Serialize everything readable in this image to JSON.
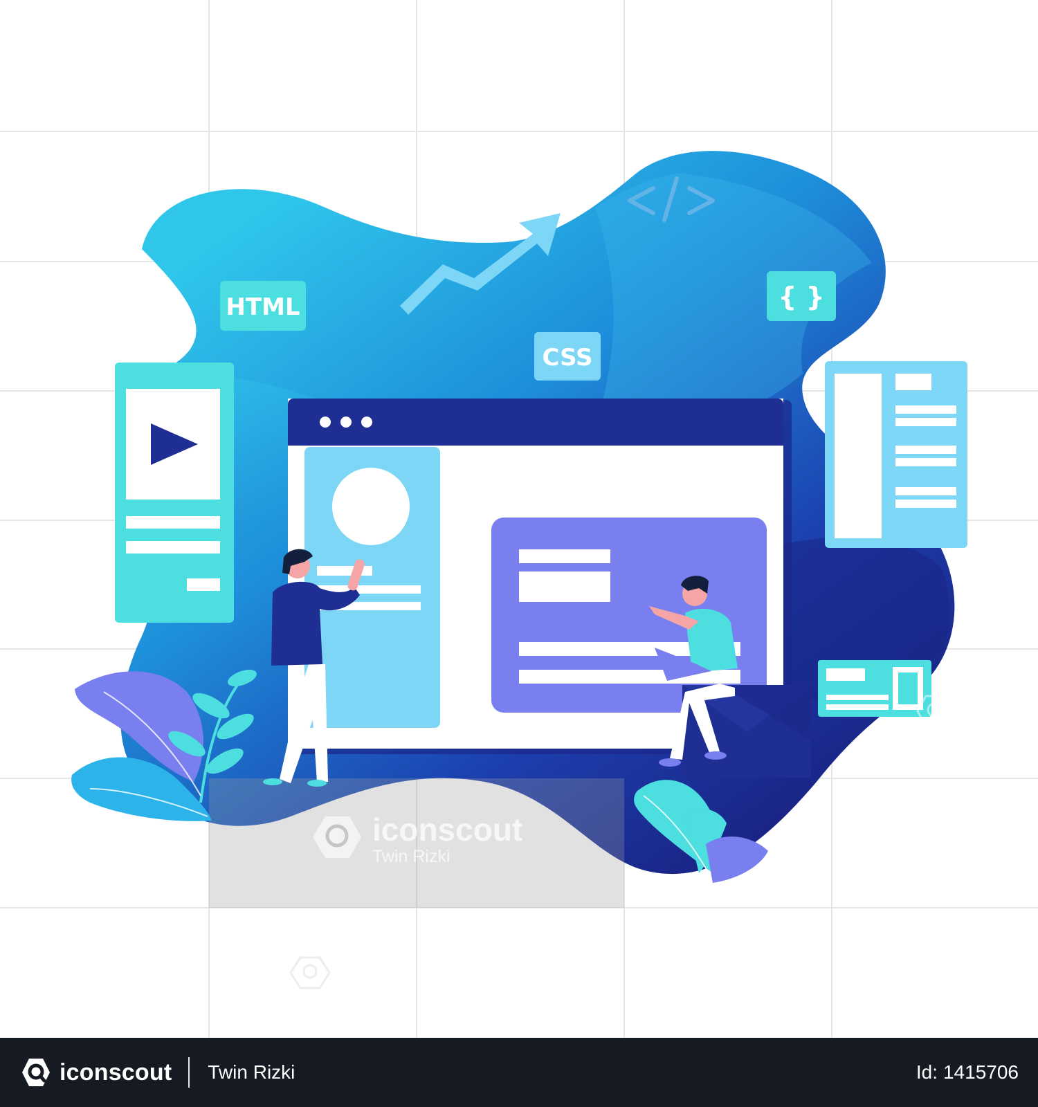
{
  "illustration": {
    "tags": {
      "html": "HTML",
      "css": "CSS",
      "braces": "{ }",
      "code": "</>"
    },
    "icons": [
      "trend-arrow-icon",
      "play-icon",
      "code-icon",
      "braces-icon",
      "search-icon"
    ],
    "colors": {
      "blob_light": "#2cc3e8",
      "blob_dark": "#1b2a8f",
      "browser_bar": "#1f2e93",
      "teal": "#4ddedf",
      "sky": "#7dd6f5",
      "violet": "#7a7ff0",
      "leaf_purple": "#7b80f0",
      "leaf_teal": "#4ddedf"
    }
  },
  "watermark": {
    "brand": "iconscout",
    "author": "Twin Rizki"
  },
  "footer": {
    "brand": "iconscout",
    "author": "Twin Rizki",
    "id_label": "Id:",
    "id_value": "1415706"
  }
}
